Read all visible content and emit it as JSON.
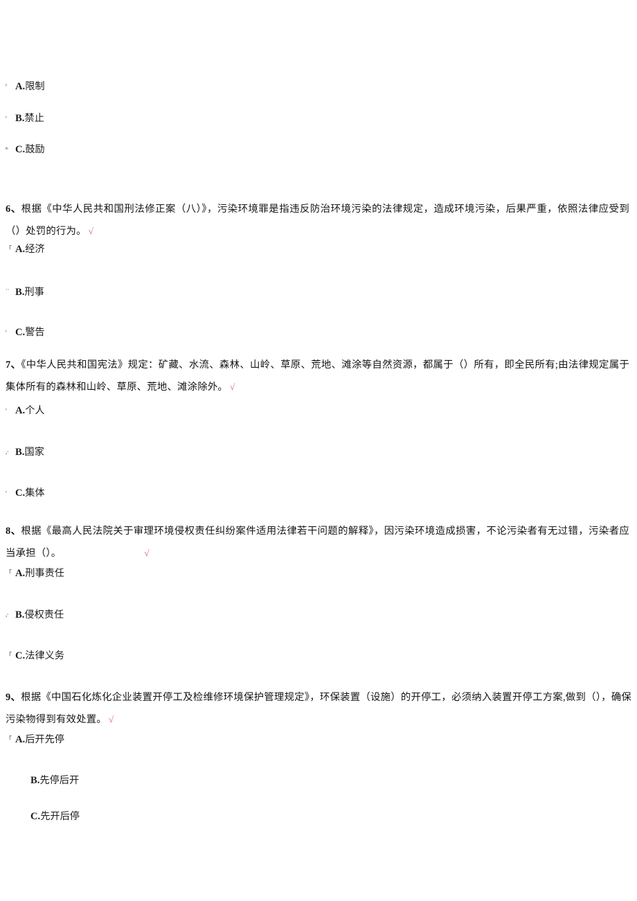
{
  "document": {
    "background_color": "#ffffff",
    "text_color": "#1a1a1a",
    "tick_color": "#e0607e",
    "tick_glyph": "√"
  },
  "questions": [
    {
      "id": "q5-continued",
      "number": "",
      "stem": "",
      "has_tick": false,
      "options": [
        {
          "marker": "ᶠ",
          "letter": "A.",
          "text": "限制",
          "indent": 0,
          "selected": false
        },
        {
          "marker": "ʳ",
          "letter": "B.",
          "text": "禁止",
          "indent": 0,
          "selected": false
        },
        {
          "marker": "ᶠᵉ",
          "letter": "C.",
          "text": "鼓励",
          "indent": 0,
          "selected": false
        }
      ]
    },
    {
      "id": "q6",
      "number": "6、",
      "stem": "根据《中华人民共和国刑法修正案（八）》，污染环境罪是指违反防治环境污染的法律规定，造成环境污染，后果严重，依照法律应受到（）处罚的行为。",
      "has_tick": true,
      "tick_wide": false,
      "options": [
        {
          "marker": "「",
          "letter": "A.",
          "text": "经济",
          "indent": 0,
          "selected": false
        },
        {
          "marker": "˙˙",
          "letter": "B.",
          "text": "刑事",
          "indent": 0,
          "selected": true
        },
        {
          "marker": "ʳ",
          "letter": "C.",
          "text": "警告",
          "indent": 0,
          "selected": false
        }
      ]
    },
    {
      "id": "q7",
      "number": "7、",
      "stem": "《中华人民共和国宪法》规定：矿藏、水流、森林、山岭、草原、荒地、滩涂等自然资源，都属于（）所有，即全民所有;由法律规定属于集体所有的森林和山岭、草原、荒地、滩涂除外。",
      "has_tick": true,
      "tick_wide": false,
      "options": [
        {
          "marker": "ʳ",
          "letter": "A.",
          "text": "个人",
          "indent": 0,
          "selected": false
        },
        {
          "marker": ",·",
          "letter": "B.",
          "text": "国家",
          "indent": 0,
          "selected": true
        },
        {
          "marker": "ʳ",
          "letter": "C.",
          "text": "集体",
          "indent": 0,
          "selected": false
        }
      ]
    },
    {
      "id": "q8",
      "number": "8、",
      "stem": "根据《最高人民法院关于审理环境侵权责任纠纷案件适用法律若干问题的解释》，因污染环境造成损害，不论污染者有无过错，污染者应当承担（）。",
      "has_tick": true,
      "tick_wide": true,
      "options": [
        {
          "marker": "「",
          "letter": "A.",
          "text": "刑事责任",
          "indent": 0,
          "selected": false
        },
        {
          "marker": ",·",
          "letter": "B.",
          "text": "侵权责任",
          "indent": 0,
          "selected": true
        },
        {
          "marker": "「",
          "letter": "C.",
          "text": "法律义务",
          "indent": 0,
          "selected": false
        }
      ]
    },
    {
      "id": "q9",
      "number": "9、",
      "stem": "根据《中国石化炼化企业装置开停工及检维修环境保护管理规定》，环保装置（设施）的开停工，必须纳入装置开停工方案,做到（），确保污染物得到有效处置。",
      "has_tick": true,
      "tick_wide": false,
      "options": [
        {
          "marker": "「",
          "letter": "A.",
          "text": "后开先停",
          "indent": 0,
          "selected": false
        },
        {
          "marker": "",
          "letter": "B.",
          "text": "先停后开",
          "indent": 1,
          "selected": false
        },
        {
          "marker": "",
          "letter": "C.",
          "text": "先开后停",
          "indent": 1,
          "selected": false
        }
      ]
    }
  ]
}
